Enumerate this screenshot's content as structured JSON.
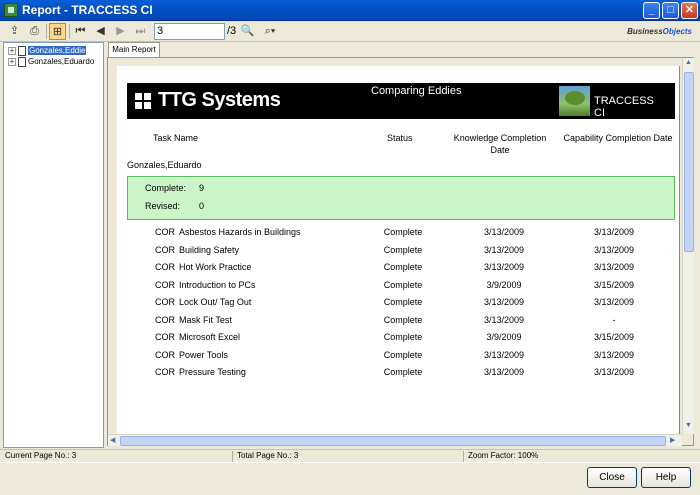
{
  "window": {
    "title": "Report - TRACCESS CI",
    "minimize": "_",
    "maximize": "□",
    "close": "✕"
  },
  "toolbar": {
    "page_input": "3",
    "page_total": "/3",
    "brand_prefix": "Business",
    "brand_suffix": "Objects",
    "icons": [
      "export-icon",
      "print-icon",
      "group-tree-icon",
      "first-page-icon",
      "prev-page-icon",
      "next-page-icon",
      "last-page-icon",
      "search-icon",
      "zoom-icon"
    ]
  },
  "tree": {
    "items": [
      {
        "label": "Gonzales,Eddie",
        "selected": true
      },
      {
        "label": "Gonzales,Eduardo",
        "selected": false
      }
    ]
  },
  "tabs": [
    {
      "label": "Main Report"
    }
  ],
  "report": {
    "company": "TTG Systems",
    "title": "Comparing Eddies",
    "product": "TRACCESS CI",
    "columns": {
      "task_name": "Task Name",
      "status": "Status",
      "knowledge": "Knowledge  Completion Date",
      "capability": "Capability Completion Date"
    },
    "person": "Gonzales,Eduardo",
    "summary": {
      "complete_label": "Complete:",
      "complete_value": "9",
      "revised_label": "Revised:",
      "revised_value": "0"
    },
    "rows": [
      {
        "code": "COR",
        "name": "Asbestos Hazards in Buildings",
        "status": "Complete",
        "knowledge": "3/13/2009",
        "capability": "3/13/2009"
      },
      {
        "code": "COR",
        "name": "Building Safety",
        "status": "Complete",
        "knowledge": "3/13/2009",
        "capability": "3/13/2009"
      },
      {
        "code": "COR",
        "name": "Hot Work Practice",
        "status": "Complete",
        "knowledge": "3/13/2009",
        "capability": "3/13/2009"
      },
      {
        "code": "COR",
        "name": "Introduction to PCs",
        "status": "Complete",
        "knowledge": "3/9/2009",
        "capability": "3/15/2009"
      },
      {
        "code": "COR",
        "name": "Lock Out/ Tag Out",
        "status": "Complete",
        "knowledge": "3/13/2009",
        "capability": "3/13/2009"
      },
      {
        "code": "COR",
        "name": "Mask Fit Test",
        "status": "Complete",
        "knowledge": "3/13/2009",
        "capability": "-"
      },
      {
        "code": "COR",
        "name": "Microsoft Excel",
        "status": "Complete",
        "knowledge": "3/9/2009",
        "capability": "3/15/2009"
      },
      {
        "code": "COR",
        "name": "Power Tools",
        "status": "Complete",
        "knowledge": "3/13/2009",
        "capability": "3/13/2009"
      },
      {
        "code": "COR",
        "name": "Pressure Testing",
        "status": "Complete",
        "knowledge": "3/13/2009",
        "capability": "3/13/2009"
      }
    ]
  },
  "statusbar": {
    "current_page": "Current Page No.: 3",
    "total_page": "Total Page No.: 3",
    "zoom": "Zoom Factor: 100%"
  },
  "buttons": {
    "close": "Close",
    "help": "Help"
  },
  "colors": {
    "title_bar": "#0a5fd6",
    "summary_bg": "#ccf4c9",
    "selection": "#316ac5"
  }
}
